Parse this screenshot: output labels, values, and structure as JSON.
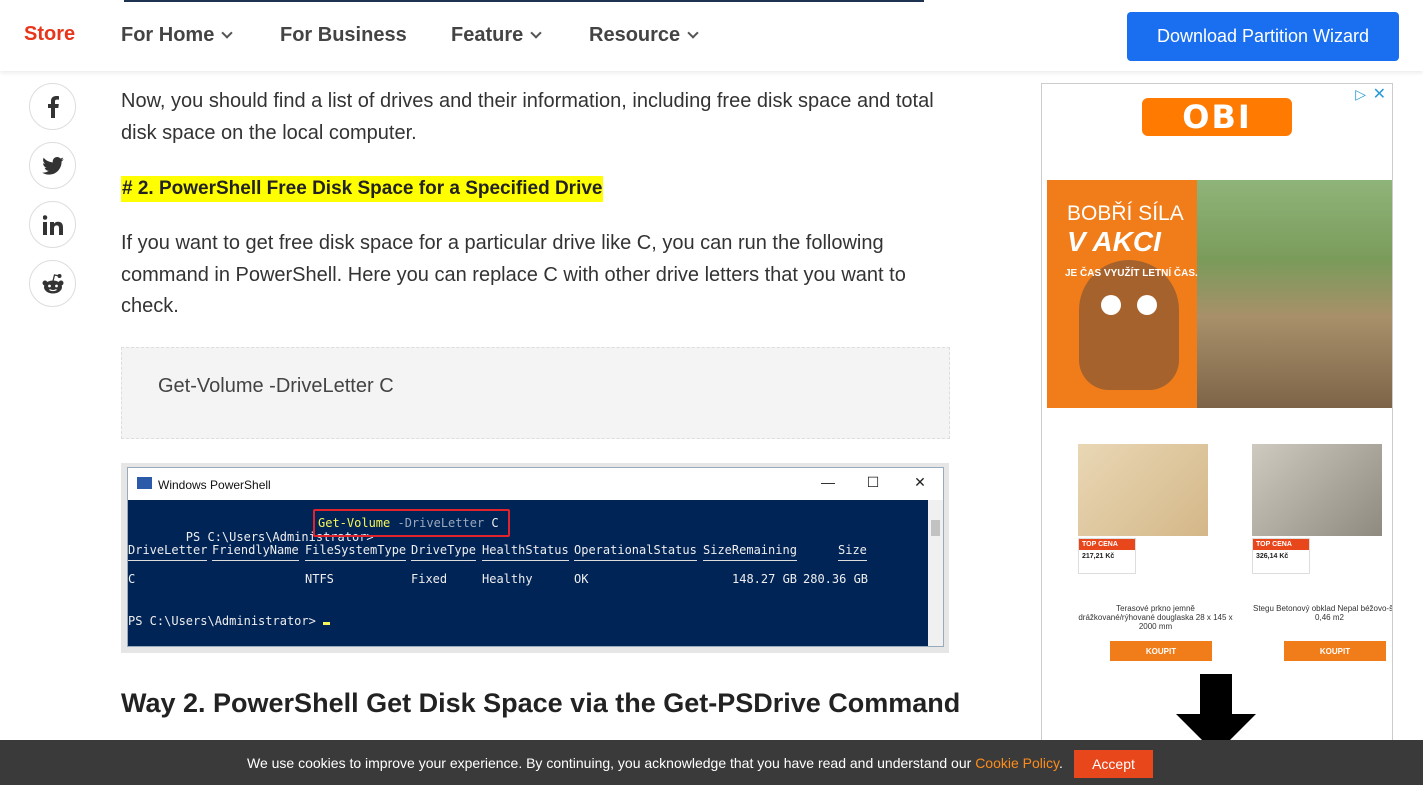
{
  "nav": {
    "brand": "Store",
    "items": [
      {
        "label": "For Home",
        "dropdown": true
      },
      {
        "label": "For Business",
        "dropdown": false
      },
      {
        "label": "Feature",
        "dropdown": true
      },
      {
        "label": "Resource",
        "dropdown": true
      }
    ],
    "cta": "Download Partition Wizard"
  },
  "share": [
    "facebook-icon",
    "twitter-icon",
    "linkedin-icon",
    "reddit-icon"
  ],
  "article": {
    "para1": "Now, you should find a list of drives and their information, including free disk space and total disk space on the local computer.",
    "heading_highlight": "# 2. PowerShell Free Disk Space for a Specified Drive",
    "para2": "If you want to get free disk space for a particular drive like C, you can run the following command in PowerShell. Here you can replace C with other drive letters that you want to check.",
    "code": "Get-Volume -DriveLetter C",
    "h2": "Way 2. PowerShell Get Disk Space via the Get-PSDrive Command"
  },
  "screenshot": {
    "title": "Windows PowerShell",
    "prompt": "PS C:\\Users\\Administrator>",
    "cmd": "Get-Volume",
    "param": "-DriveLetter",
    "arg": "C",
    "headers": [
      "DriveLetter",
      "FriendlyName",
      "FileSystemType",
      "DriveType",
      "HealthStatus",
      "OperationalStatus",
      "SizeRemaining",
      "Size"
    ],
    "row": [
      "C",
      "",
      "NTFS",
      "Fixed",
      "Healthy",
      "OK",
      "148.27 GB",
      "280.36 GB"
    ],
    "prompt2": "PS C:\\Users\\Administrator>"
  },
  "ad": {
    "brand": "OBI",
    "banner_line1": "BOBŘÍ SÍLA",
    "banner_line2": "V AKCI",
    "banner_line3": "JE ČAS VYUŽÍT LETNÍ ČAS.",
    "products": [
      {
        "badge": "TOP CENA",
        "price": "217,21 Kč",
        "desc": "Terasové prkno jemně drážkované/rýhované douglaska 28 x 145 x 2000 mm",
        "buy": "KOUPIT"
      },
      {
        "badge": "TOP CENA",
        "price": "326,14 Kč",
        "desc": "Stegu Betonový obklad Nepal béžovo-šedý 0,46 m2",
        "buy": "KOUPIT"
      }
    ]
  },
  "cookie": {
    "text": "We use cookies to improve your experience. By continuing, you acknowledge that you have read and understand our ",
    "link": "Cookie Policy",
    "after": ".",
    "accept": "Accept"
  }
}
